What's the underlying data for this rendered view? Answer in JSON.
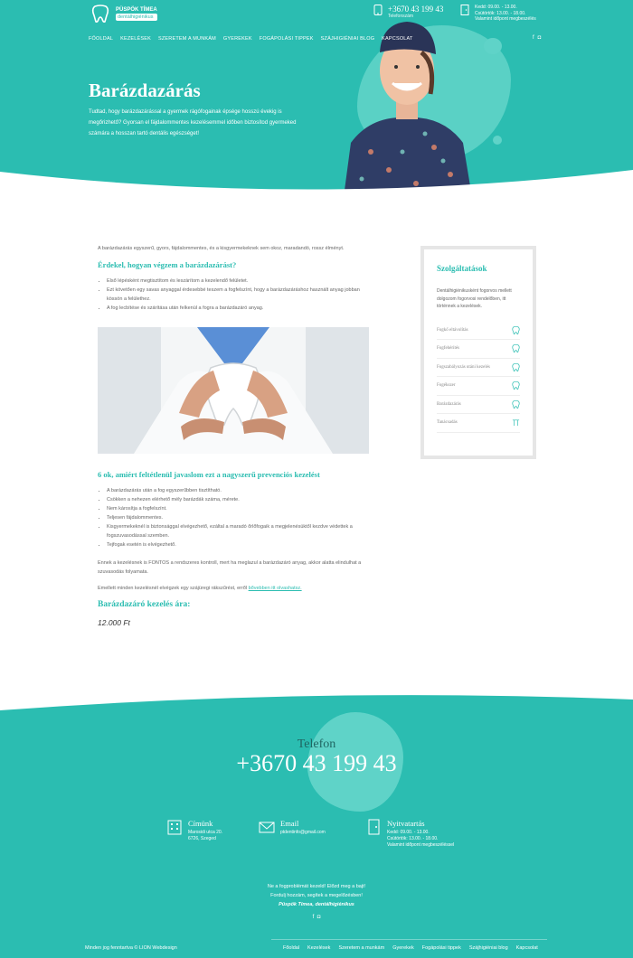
{
  "colors": {
    "accent": "#2bbdb1",
    "accent_light": "#5fd3c8",
    "footer_dark_text": "#1f6662"
  },
  "header": {
    "logo": {
      "name": "PÜSPÖK TÍMEA",
      "sub": "dentálhigiénikus"
    },
    "phone": {
      "number": "+3670 43 199 43",
      "label": "Telefonszám"
    },
    "hours": {
      "line1": "Kedd: 09.00. - 13.00.",
      "line2": "Csütörtök: 13.00. - 18.00.",
      "line3": "Valamint időpont megbeszélés"
    },
    "nav": [
      "FŐOLDAL",
      "KEZELÉSEK",
      "SZERETEM A MUNKÁM",
      "GYEREKEK",
      "FOGÁPOLÁSI TIPPEK",
      "SZÁJHIGIÉNIAI BLOG",
      "KAPCSOLAT"
    ],
    "social": [
      "facebook-icon",
      "instagram-icon"
    ]
  },
  "hero": {
    "title": "Barázdazárás",
    "description": "Tudtad, hogy barázdazárással a gyermek rágófogainak épsége hosszú évekig is megőrizhető? Gyorsan el fájdalommentes kezelésemmel időben biztosítod gyermeked számára a hosszan tartó dentális egészséget!"
  },
  "article": {
    "intro": "A barázdazárás egyszerű, gyors, fájdalommentes, és a kisgyermekeknek sem okoz, maradandó, rossz élményt.",
    "h1": "Érdekel, hogyan végzem a barázdazárást?",
    "steps": [
      "Első lépésként megtisztítom és leszárítom a kezelendő felületet.",
      "Ezt követően egy savas anyaggal érdesebbé teszem a fogfelszínt, hogy a barázdazáráshoz használt anyag jobban kössön a felülethez.",
      "A fog lecbítése és szárítása után felkenül a fogra a barázdazáró anyag."
    ],
    "h2": "6 ok, amiért feltétlenül javaslom ezt a nagyszerű prevenciós kezelést",
    "reasons": [
      "A barázdazárás után a fog egyszerűbben tisztítható.",
      "Csökken a nehezen elérhető mély barázdák száma, mérete.",
      "Nem károsítja a fogfelszínt.",
      "Teljesen fájdalommentes.",
      "Kisgyermekeknél is biztonsággal elvégezhető, ezáltal a maradó őrlőfogaik a megjelenésüktől kezdve védettek a fogszuvasodással szemben.",
      "Tejfogak esetén is elvégezhető."
    ],
    "note1": "Ennek a kezelésnek is FONTOS a rendszeres kontroll, mert ha meglazul a barázdazáró anyag, akkor alatta elindulhat a szuvasodás folyamata.",
    "note2_prefix": "Emellett minden kezelésnél elvégzek egy szájüregi rákszűrést, erről ",
    "note2_link": "bővebben itt olvashatsz.",
    "price_title": "Barázdazáró kezelés ára:",
    "price": "12.000 Ft"
  },
  "sidebar": {
    "title": "Szolgáltatások",
    "intro": "Dentálhigiénikusként fogorvos mellett dolgozom fogorvosi rendelőben, itt történnek a kezelések.",
    "items": [
      "Fogkő eltávolítás",
      "Fogfehérítés",
      "Fogszabályozás utáni kezelés",
      "Fogékszer",
      "Barázdazárás",
      "Tanácsadás"
    ]
  },
  "footer": {
    "phone_label": "Telefon",
    "phone": "+3670 43 199 43",
    "address": {
      "title": "Címünk",
      "line1": "Marosidi utca 20.",
      "line2": "6726, Szeged"
    },
    "email": {
      "title": "Email",
      "value": "ptdentinfo@gmail.com"
    },
    "hours": {
      "title": "Nyitvatartás",
      "line1": "Kedd: 09.00. - 13.00.",
      "line2": "Csütörtök: 13.00. - 18.00.",
      "line3": "Valamint időpont megbeszéléssel"
    },
    "cta1": "Ne a fogproblémát kezeld! Előzd meg a bajt!",
    "cta2": "Fordulj hozzám, segítek a megelőzésben!",
    "cta3": "Püspök Tímea, dentálhigiénikus",
    "copyright": "Minden jog fenntartva © LION Webdesign",
    "nav": [
      "Főoldal",
      "Kezelések",
      "Szeretem a munkám",
      "Gyerekek",
      "Fogápolási tippek",
      "Szájhigiéniai blog",
      "Kapcsolat"
    ]
  }
}
